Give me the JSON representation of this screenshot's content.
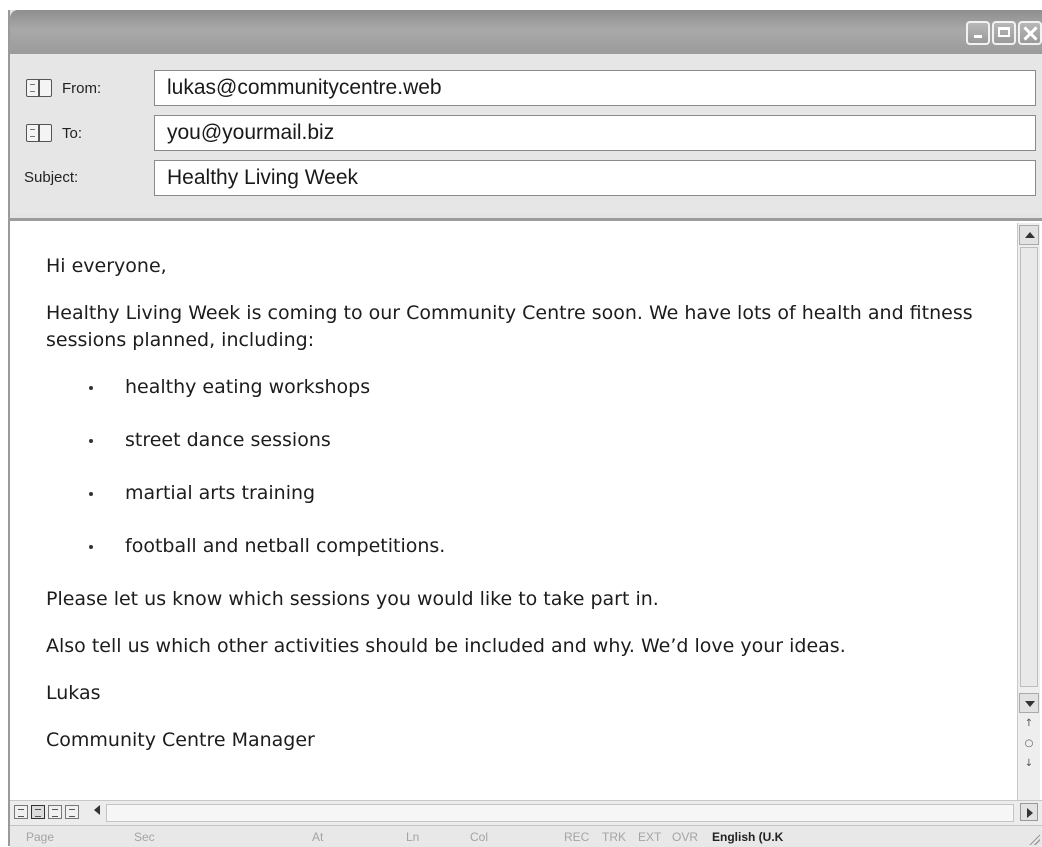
{
  "header": {
    "from": {
      "label": "From:",
      "value": "lukas@communitycentre.web",
      "icon": "address-book-icon"
    },
    "to": {
      "label": "To:",
      "value": "you@yourmail.biz",
      "icon": "address-book-icon"
    },
    "subject": {
      "label": "Subject:",
      "value": "Healthy Living Week"
    }
  },
  "message": {
    "greeting": "Hi everyone,",
    "intro": "Healthy Living Week is coming to our Community Centre soon. We have lots of health and fitness sessions planned, including:",
    "bullets": [
      "healthy eating workshops",
      "street dance sessions",
      "martial arts training",
      "football and netball competitions."
    ],
    "request": "Please let us know which sessions you would like to take part in.",
    "ideas": "Also tell us which other activities should be included and why. We’d love your ideas.",
    "signature_name": "Lukas",
    "signature_title": "Community Centre Manager"
  },
  "statusbar": {
    "page": "Page",
    "sec": "Sec",
    "at": "At",
    "ln": "Ln",
    "col": "Col",
    "rec": "REC",
    "trk": "TRK",
    "ext": "EXT",
    "ovr": "OVR",
    "language": "English (U.K"
  }
}
